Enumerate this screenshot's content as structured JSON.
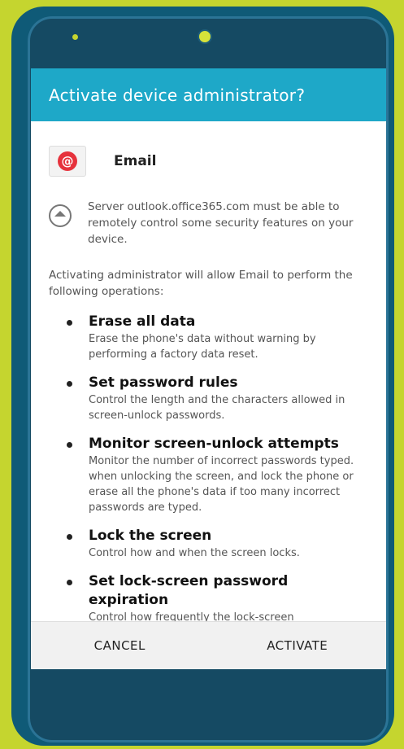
{
  "dialog": {
    "title": "Activate device administrator?",
    "app_name": "Email",
    "server_message": "Server outlook.office365.com must be able to remotely control some security features on your device.",
    "intro": "Activating administrator will allow Email to perform the following operations:",
    "operations": [
      {
        "title": "Erase all data",
        "desc": "Erase the phone's data without warning by performing a factory data reset."
      },
      {
        "title": "Set password rules",
        "desc": "Control the length and the characters allowed in screen-unlock passwords."
      },
      {
        "title": "Monitor screen-unlock attempts",
        "desc": "Monitor the number of incorrect passwords typed. when unlocking the screen, and lock the phone or erase all the phone's data if too many incorrect passwords are typed."
      },
      {
        "title": "Lock the screen",
        "desc": "Control how and when the screen locks."
      },
      {
        "title": "Set lock-screen password expiration",
        "desc": "Control how frequently the lock-screen"
      }
    ],
    "cancel_label": "CANCEL",
    "activate_label": "ACTIVATE"
  },
  "colors": {
    "background": "#c5d52f",
    "phone_body": "#0f5a77",
    "titlebar": "#1ea8c8",
    "email_icon": "#e6323c"
  },
  "icons": {
    "app_icon": "email-at-icon",
    "server_icon": "expand-up-icon"
  }
}
